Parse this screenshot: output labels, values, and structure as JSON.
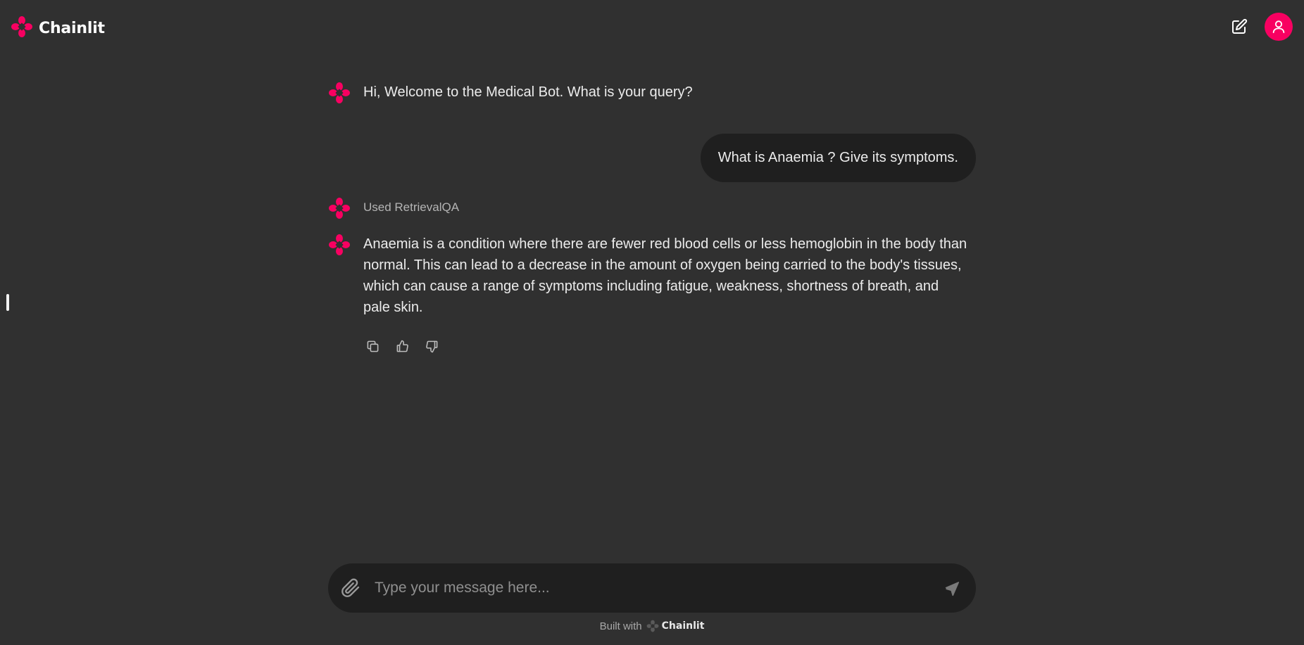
{
  "header": {
    "brand_name": "Chainlit",
    "brand_color": "#f80061",
    "new_chat_icon": "edit-icon",
    "user_icon": "user-icon"
  },
  "messages": [
    {
      "role": "assistant",
      "text": "Hi, Welcome to the Medical Bot. What is your query?"
    },
    {
      "role": "user",
      "text": "What is Anaemia ? Give its symptoms."
    },
    {
      "role": "step",
      "text": "Used RetrievalQA"
    },
    {
      "role": "assistant",
      "text": "Anaemia is a condition where there are fewer red blood cells or less hemoglobin in the body than normal. This can lead to a decrease in the amount of oxygen being carried to the body's tissues, which can cause a range of symptoms including fatigue, weakness, shortness of breath, and pale skin."
    }
  ],
  "feedback_icons": [
    "copy-icon",
    "thumbs-up-icon",
    "thumbs-down-icon"
  ],
  "composer": {
    "placeholder": "Type your message here...",
    "attach_icon": "paperclip-icon",
    "send_icon": "send-icon"
  },
  "footer": {
    "built_with": "Built with",
    "brand": "Chainlit"
  },
  "colors": {
    "background": "#303030",
    "surface": "#1f1f1f",
    "accent": "#f80061"
  }
}
